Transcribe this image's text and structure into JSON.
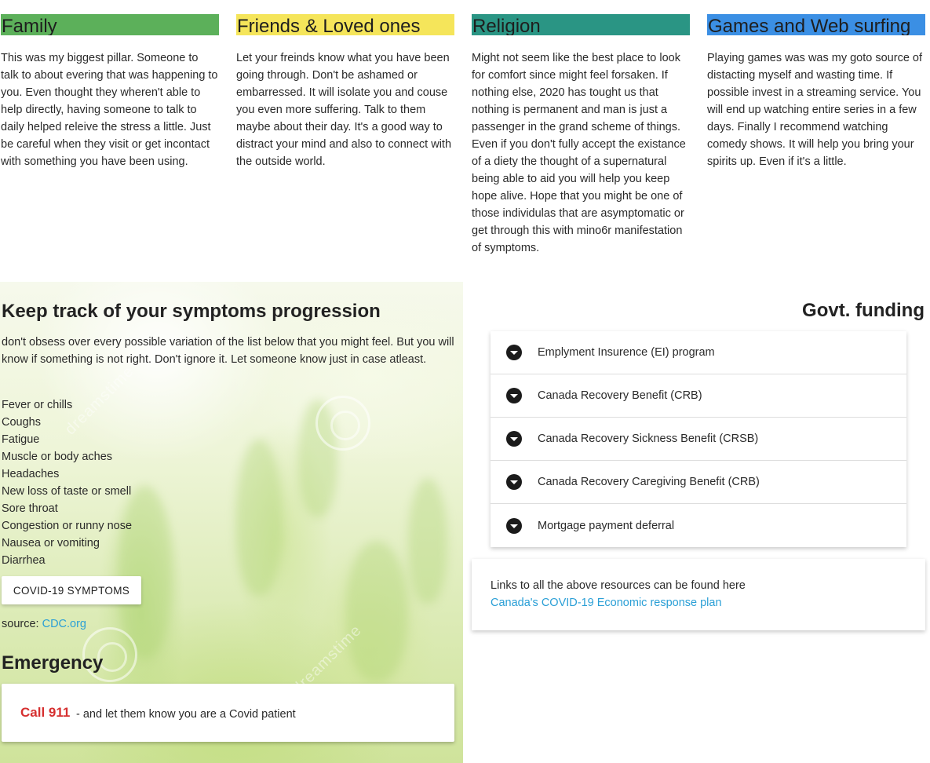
{
  "cards": [
    {
      "title": "Family",
      "color": "#5cb05a",
      "text": "This was my biggest pillar. Someone to talk to about evering that was happening to you. Even thought they wheren't able to help directly, having someone to talk to daily helped releive the stress a little. Just be careful when they visit or get incontact with something you have been using."
    },
    {
      "title": "Friends & Loved ones",
      "color": "#f5e55a",
      "text": "Let your freinds know what you have been going through. Don't be ashamed or embarressed. It will isolate you and couse you even more suffering. Talk to them maybe about their day. It's a good way to distract your mind and also to connect with the outside world."
    },
    {
      "title": "Religion",
      "color": "#2a9584",
      "text": "Might not seem like the best place to look for comfort since might feel forsaken. If nothing else, 2020 has tought us that nothing is permanent and man is just a passenger in the grand scheme of things. Even if you don't fully accept the existance of a diety the thought of a supernatural being able to aid you will help you keep hope alive. Hope that you might be one of those individulas that are asymptomatic or get through this with mino6r manifestation of symptoms."
    },
    {
      "title": "Games and Web surfing",
      "color": "#3b8fe4",
      "text": "Playing games was was my goto source of distacting myself and wasting time. If possible invest in a streaming service. You will end up watching entire series in a few days. Finally I recommend watching comedy shows. It will help you bring your spirits up. Even if it's a little."
    }
  ],
  "symptoms": {
    "title": "Keep track of your symptoms progression",
    "intro": "don't obsess over every possible variation of the list below that you might feel. But you will know if something is not right. Don't ignore it. Let someone know just in case atleast.",
    "items": [
      "Fever or chills",
      "Coughs",
      "Fatigue",
      "Muscle or body aches",
      "Headaches",
      "New loss of taste or smell",
      "Sore throat",
      "Congestion or runny nose",
      "Nausea or vomiting",
      "Diarrhea"
    ],
    "button_label": "COVID-19 SYMPTOMS",
    "source_label": "source:",
    "source_link": "CDC.org",
    "watermark_text": "dreamstime"
  },
  "emergency": {
    "title": "Emergency",
    "call": "Call 911",
    "message": "- and let them know you are a Covid patient"
  },
  "funding": {
    "title": "Govt. funding",
    "items": [
      "Emplyment Insurence (EI) program",
      "Canada Recovery Benefit (CRB)",
      "Canada Recovery Sickness Benefit (CRSB)",
      "Canada Recovery Caregiving Benefit (CRB)",
      "Mortgage payment deferral"
    ],
    "links_text": "Links to all the above resources can be found here",
    "links_link": "Canada's COVID-19 Economic response plan"
  },
  "colors": {
    "link": "#2a9fd6",
    "emergency": "#d63030"
  }
}
